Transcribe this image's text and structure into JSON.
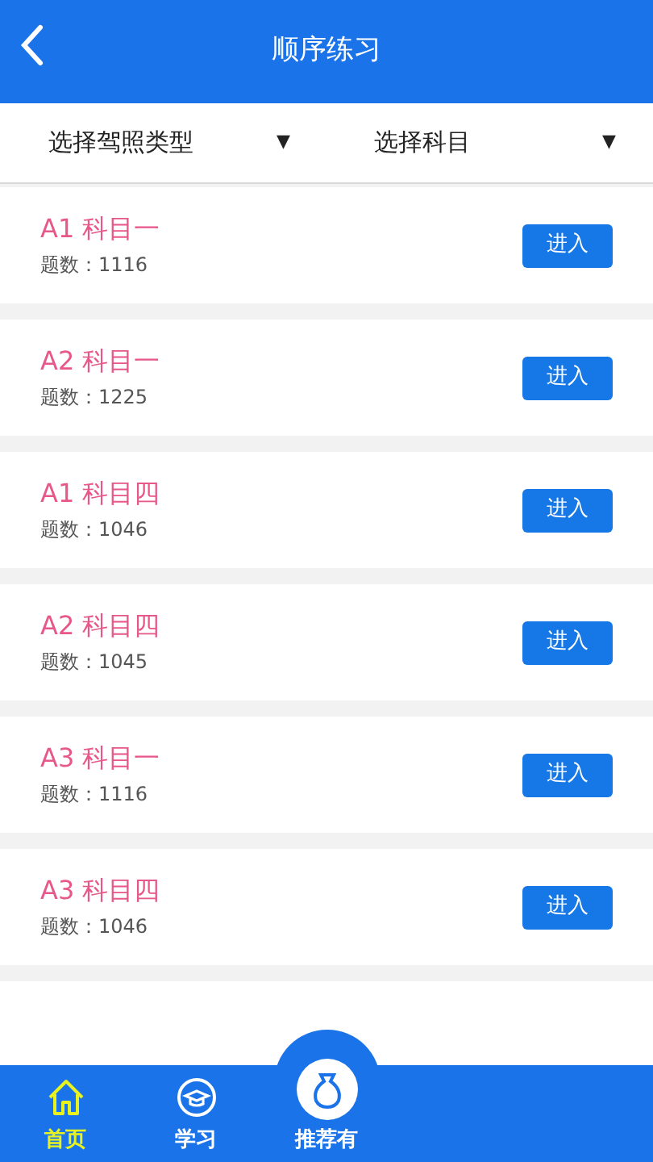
{
  "header": {
    "title": "顺序练习"
  },
  "filters": [
    {
      "label": "选择驾照类型",
      "caret": "▼"
    },
    {
      "label": "选择科目",
      "caret": "▼"
    }
  ],
  "items": [
    {
      "title": "A1 科目一",
      "count": "题数：1116",
      "button": "进入"
    },
    {
      "title": "A2 科目一",
      "count": "题数：1225",
      "button": "进入"
    },
    {
      "title": "A1 科目四",
      "count": "题数：1046",
      "button": "进入"
    },
    {
      "title": "A2 科目四",
      "count": "题数：1045",
      "button": "进入"
    },
    {
      "title": "A3 科目一",
      "count": "题数：1116",
      "button": "进入"
    },
    {
      "title": "A3 科目四",
      "count": "题数：1046",
      "button": "进入"
    }
  ],
  "tabbar": [
    {
      "label": "首页",
      "kind": "home",
      "selected": true
    },
    {
      "label": "学习",
      "kind": "study",
      "selected": false
    },
    {
      "label": "推荐有",
      "kind": "reward",
      "selected": false
    }
  ]
}
